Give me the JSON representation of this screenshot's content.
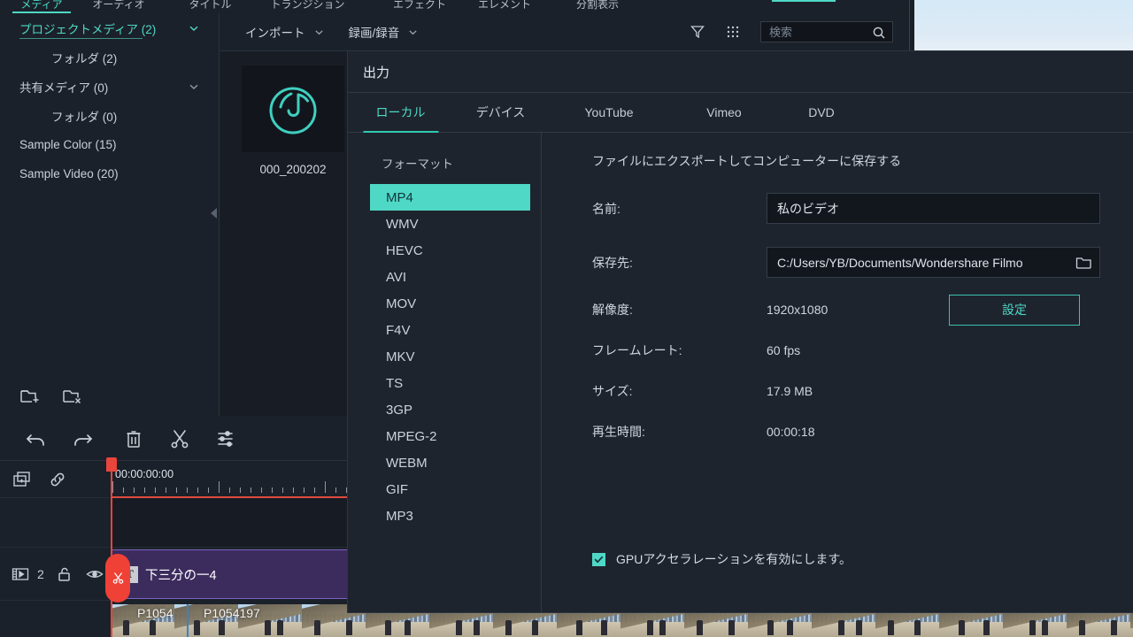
{
  "top_tabs": [
    {
      "label": "メディア",
      "active": true
    },
    {
      "label": "オーディオ",
      "active": false
    },
    {
      "label": "タイトル",
      "active": false
    },
    {
      "label": "トランジション",
      "active": false
    },
    {
      "label": "エフェクト",
      "active": false
    },
    {
      "label": "エレメント",
      "active": false
    },
    {
      "label": "分割表示",
      "active": false
    }
  ],
  "library": {
    "items": [
      {
        "label": "プロジェクトメディア (2)",
        "active": true,
        "indent": false,
        "chevron": true
      },
      {
        "label": "フォルダ (2)",
        "active": false,
        "indent": true,
        "chevron": false
      },
      {
        "label": "共有メディア (0)",
        "active": false,
        "indent": false,
        "chevron": true
      },
      {
        "label": "フォルダ (0)",
        "active": false,
        "indent": true,
        "chevron": false
      },
      {
        "label": "Sample Color (15)",
        "active": false,
        "indent": false,
        "chevron": false
      },
      {
        "label": "Sample Video (20)",
        "active": false,
        "indent": false,
        "chevron": false
      }
    ]
  },
  "media_toolbar": {
    "import_label": "インポート",
    "record_label": "録画/録音",
    "search_placeholder": "検索",
    "search_value": ""
  },
  "media_items": [
    {
      "caption": "000_200202",
      "kind": "audio"
    }
  ],
  "dialog": {
    "title": "出力",
    "tabs": [
      {
        "label": "ローカル",
        "active": true
      },
      {
        "label": "デバイス",
        "active": false
      },
      {
        "label": "YouTube",
        "active": false
      },
      {
        "label": "Vimeo",
        "active": false
      },
      {
        "label": "DVD",
        "active": false
      }
    ],
    "format_heading": "フォーマット",
    "formats": [
      {
        "label": "MP4",
        "selected": true
      },
      {
        "label": "WMV",
        "selected": false
      },
      {
        "label": "HEVC",
        "selected": false
      },
      {
        "label": "AVI",
        "selected": false
      },
      {
        "label": "MOV",
        "selected": false
      },
      {
        "label": "F4V",
        "selected": false
      },
      {
        "label": "MKV",
        "selected": false
      },
      {
        "label": "TS",
        "selected": false
      },
      {
        "label": "3GP",
        "selected": false
      },
      {
        "label": "MPEG-2",
        "selected": false
      },
      {
        "label": "WEBM",
        "selected": false
      },
      {
        "label": "GIF",
        "selected": false
      },
      {
        "label": "MP3",
        "selected": false
      }
    ],
    "description": "ファイルにエクスポートしてコンピューターに保存する",
    "fields": {
      "name_label": "名前:",
      "name_value": "私のビデオ",
      "save_to_label": "保存先:",
      "save_to_value": "C:/Users/YB/Documents/Wondershare Filmo",
      "resolution_label": "解像度:",
      "resolution_value": "1920x1080",
      "settings_button": "設定",
      "framerate_label": "フレームレート:",
      "framerate_value": "60 fps",
      "size_label": "サイズ:",
      "size_value": "17.9 MB",
      "duration_label": "再生時間:",
      "duration_value": "00:00:18"
    },
    "gpu": {
      "label": "GPUアクセラレーションを有効にします。",
      "checked": true
    },
    "accent_color": "#4ed8c5"
  },
  "timeline": {
    "toolbar_icons": [
      "undo-icon",
      "redo-icon",
      "delete-icon",
      "split-icon",
      "adjust-icon"
    ],
    "timecode": "00:00:00:00",
    "track_number": "2",
    "title_clip_label": "下三分の一4",
    "video_clips": [
      {
        "label": "P1054"
      },
      {
        "label": "P1054197"
      }
    ]
  }
}
